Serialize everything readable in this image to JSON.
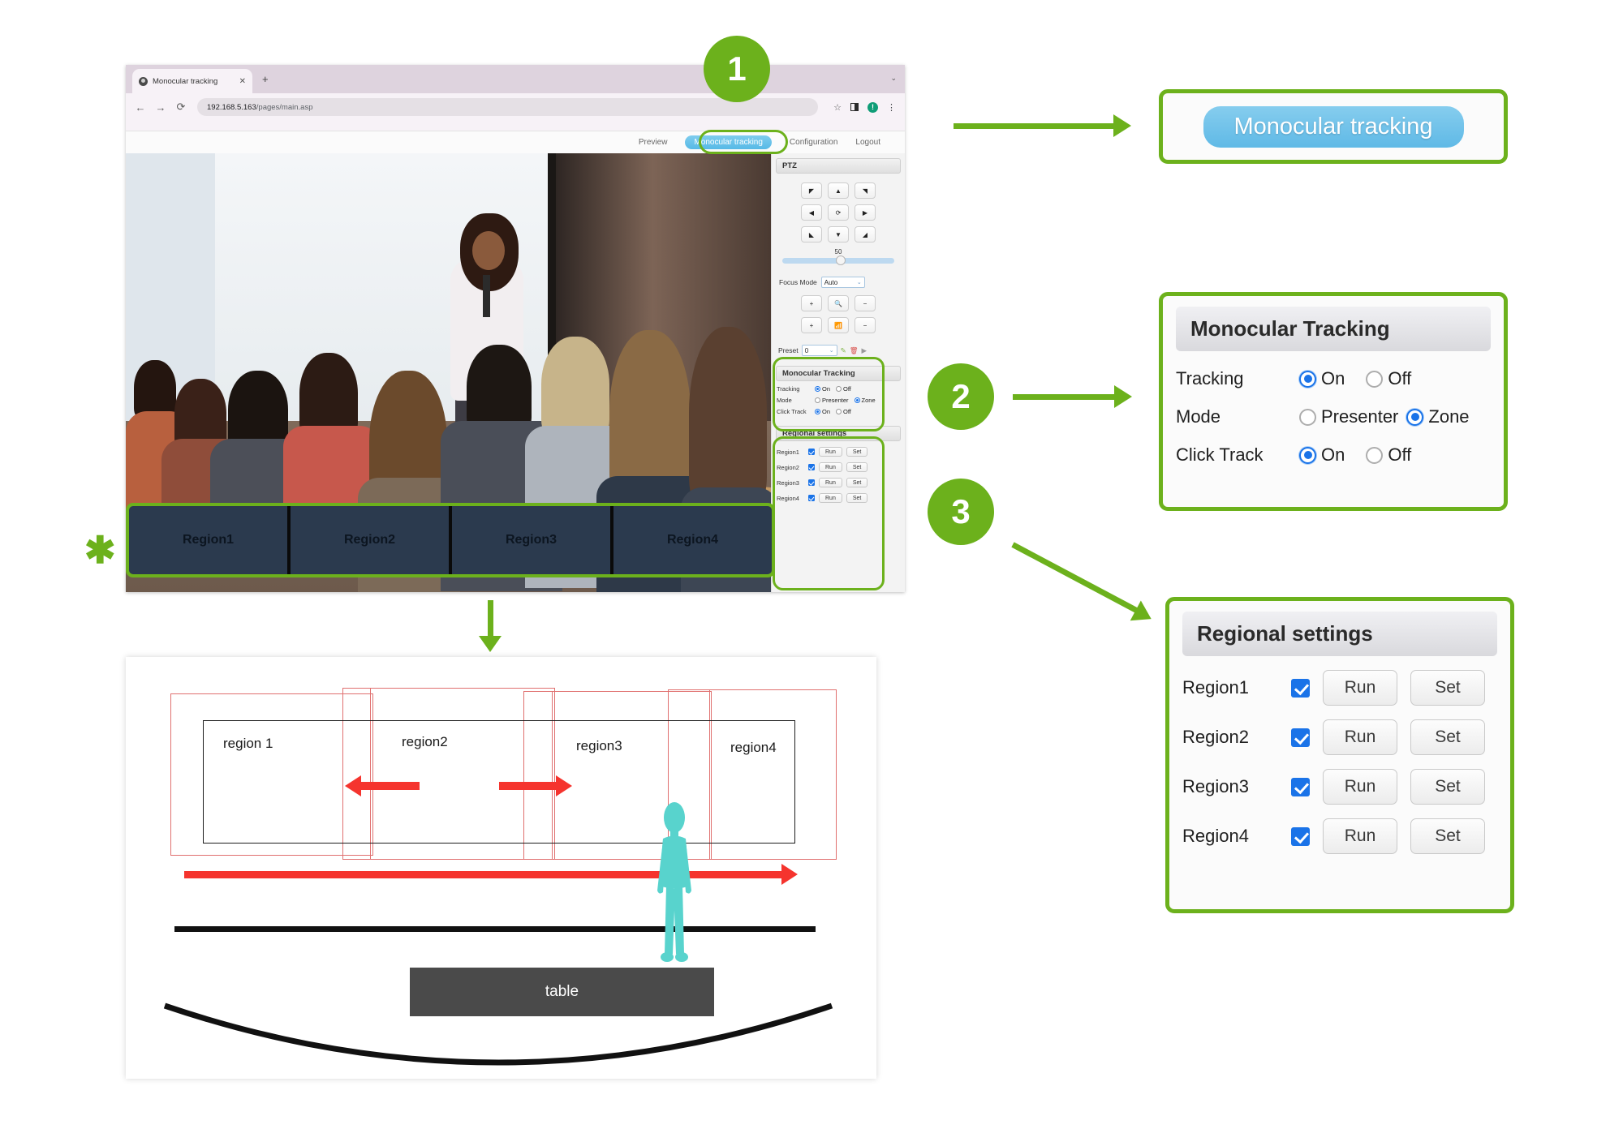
{
  "browser": {
    "tab": {
      "title": "Monocular tracking",
      "close_label": "✕",
      "newtab_label": "+",
      "window_menu": "⌄"
    },
    "nav": {
      "back": "←",
      "forward": "→",
      "reload": "⟳"
    },
    "address": {
      "host": "192.168.5.163",
      "path": "/pages/main.asp",
      "full": "192.168.5.163/pages/main.asp"
    },
    "omnibox_icons": {
      "bookmark": "☆",
      "sidepanel": "sidepanel-icon",
      "profile": "!",
      "menu": "⋮"
    }
  },
  "page_nav": {
    "items": [
      {
        "label": "Preview",
        "active": false
      },
      {
        "label": "Monocular tracking",
        "active": true
      },
      {
        "label": "Configuration",
        "active": false
      },
      {
        "label": "Logout",
        "active": false
      }
    ]
  },
  "ptz_panel": {
    "title": "PTZ",
    "dpad": [
      "◤",
      "▲",
      "◥",
      "◀",
      "⟳",
      "▶",
      "◣",
      "▼",
      "◢"
    ],
    "speed_value": "50",
    "focus_mode": {
      "label": "Focus Mode",
      "value": "Auto",
      "caret": "⌄"
    },
    "zoom_buttons": [
      "+",
      "🔍",
      "−",
      "+",
      "📶",
      "−"
    ],
    "preset": {
      "label": "Preset",
      "value": "0",
      "caret": "⌄",
      "edit": "✎",
      "delete": "🗑",
      "go": "▶"
    }
  },
  "monocular_panel_small": {
    "title": "Monocular Tracking",
    "rows": [
      {
        "label": "Tracking",
        "options": [
          {
            "text": "On",
            "selected": true
          },
          {
            "text": "Off",
            "selected": false
          }
        ]
      },
      {
        "label": "Mode",
        "options": [
          {
            "text": "Presenter",
            "selected": false
          },
          {
            "text": "Zone",
            "selected": true
          }
        ]
      },
      {
        "label": "Click Track",
        "options": [
          {
            "text": "On",
            "selected": true
          },
          {
            "text": "Off",
            "selected": false
          }
        ]
      }
    ]
  },
  "regional_panel_small": {
    "title": "Regional settings",
    "rows": [
      {
        "label": "Region1",
        "checked": true,
        "run": "Run",
        "set": "Set"
      },
      {
        "label": "Region2",
        "checked": true,
        "run": "Run",
        "set": "Set"
      },
      {
        "label": "Region3",
        "checked": true,
        "run": "Run",
        "set": "Set"
      },
      {
        "label": "Region4",
        "checked": true,
        "run": "Run",
        "set": "Set"
      }
    ]
  },
  "region_strip": {
    "cells": [
      "Region1",
      "Region2",
      "Region3",
      "Region4"
    ],
    "marker": "✱"
  },
  "badges": {
    "one": "1",
    "two": "2",
    "three": "3"
  },
  "callout1": {
    "pill_label": "Monocular tracking"
  },
  "callout2": {
    "title": "Monocular Tracking",
    "rows": [
      {
        "label": "Tracking",
        "options": [
          {
            "text": "On",
            "selected": true
          },
          {
            "text": "Off",
            "selected": false
          }
        ]
      },
      {
        "label": "Mode",
        "options": [
          {
            "text": "Presenter",
            "selected": false
          },
          {
            "text": "Zone",
            "selected": true
          }
        ]
      },
      {
        "label": "Click Track",
        "options": [
          {
            "text": "On",
            "selected": true
          },
          {
            "text": "Off",
            "selected": false
          }
        ]
      }
    ]
  },
  "callout3": {
    "title": "Regional settings",
    "rows": [
      {
        "label": "Region1",
        "checked": true,
        "run": "Run",
        "set": "Set"
      },
      {
        "label": "Region2",
        "checked": true,
        "run": "Run",
        "set": "Set"
      },
      {
        "label": "Region3",
        "checked": true,
        "run": "Run",
        "set": "Set"
      },
      {
        "label": "Region4",
        "checked": true,
        "run": "Run",
        "set": "Set"
      }
    ]
  },
  "diagram": {
    "region_labels": [
      "region 1",
      "region2",
      "region3",
      "region4"
    ],
    "table_label": "table"
  },
  "colors": {
    "accent_green": "#6cb11c",
    "blue_pill": "#5fb9e6",
    "radio_blue": "#1a73e8",
    "red_arrow": "#f5342e",
    "strip_navy": "#2b3a4e",
    "person_cyan": "#5fd6d0"
  }
}
